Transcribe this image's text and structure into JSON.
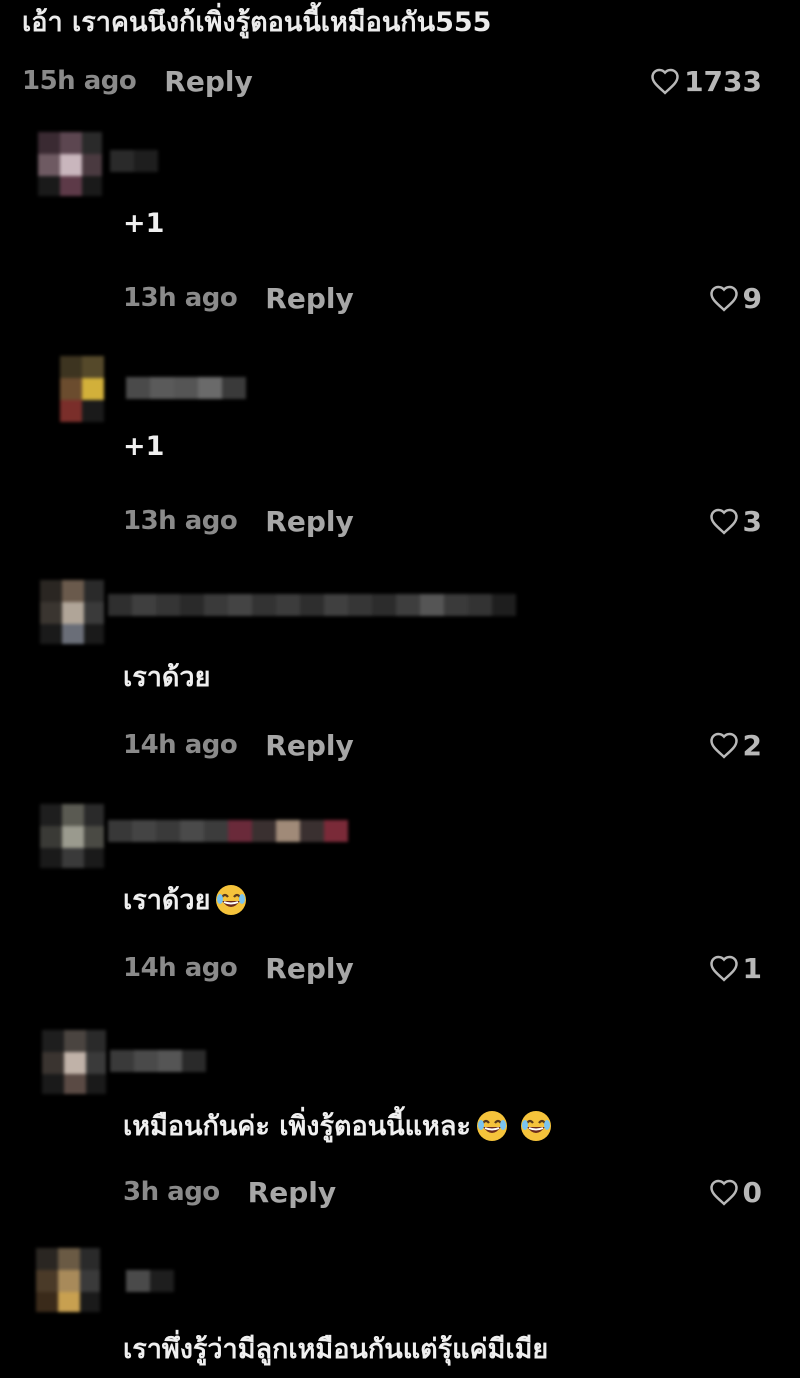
{
  "top_comment": {
    "text": "เอ้า เราคนนึงก้เพิ่งรู้ตอนนี้เหมือนกัน555",
    "time": "15h ago",
    "reply_label": "Reply",
    "likes": "1733"
  },
  "replies": [
    {
      "text": "+1",
      "time": "13h ago",
      "reply_label": "Reply",
      "likes": "9"
    },
    {
      "text": "+1",
      "time": "13h ago",
      "reply_label": "Reply",
      "likes": "3"
    },
    {
      "text": "เราด้วย",
      "time": "14h ago",
      "reply_label": "Reply",
      "likes": "2"
    },
    {
      "text": "เราด้วย",
      "time": "14h ago",
      "reply_label": "Reply",
      "likes": "1",
      "emoji": "laughing-emoji"
    },
    {
      "text": "เหมือนกันค่ะ เพิ่งรู้ตอนนี้แหละ",
      "time": "3h ago",
      "reply_label": "Reply",
      "likes": "0",
      "emoji": "laughing-emoji x2"
    },
    {
      "text": "เราพึ่งรู้ว่ามีลูกเหมือนกันแต่รุ้แค่มีเมีย"
    }
  ],
  "colors": {
    "background": "#000000",
    "text": "#f2f2f2",
    "time": "#8a8a8a",
    "reply": "#a7a7a7",
    "likes": "#b8b8b8"
  },
  "icons": {
    "like": "heart-outline-icon",
    "emoji": "laughing-face-emoji"
  }
}
